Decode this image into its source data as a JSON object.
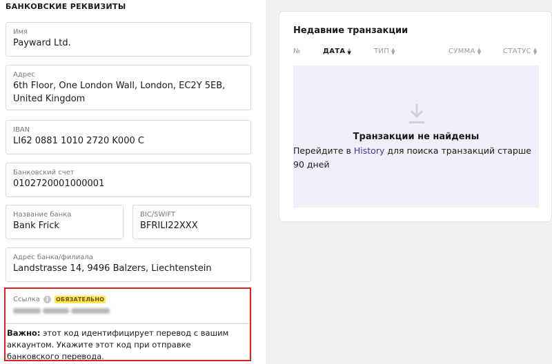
{
  "bank_details": {
    "section_title": "БАНКОВСКИЕ РЕКВИЗИТЫ",
    "name": {
      "label": "Имя",
      "value": "Payward Ltd."
    },
    "address": {
      "label": "Адрес",
      "value": "6th Floor, One London Wall, London, EC2Y 5EB, United Kingdom"
    },
    "iban": {
      "label": "IBAN",
      "value": "LI62 0881 1010 2720 K000 C"
    },
    "account": {
      "label": "Банковский счет",
      "value": "0102720001000001"
    },
    "bank_name": {
      "label": "Название банка",
      "value": "Bank Frick"
    },
    "swift": {
      "label": "BIC/SWIFT",
      "value": "BFRILI22XXX"
    },
    "bank_address": {
      "label": "Адрес банка/филиала",
      "value": "Landstrasse 14, 9496 Balzers, Liechtenstein"
    },
    "reference": {
      "label": "Ссылка",
      "badge": "ОБЯЗАТЕЛЬНО",
      "note_bold": "Важно:",
      "note_text": " этот код идентифицирует перевод с вашим аккаунтом. Укажите этот код при отправке банковского перевода."
    }
  },
  "transactions": {
    "title": "Недавние транзакции",
    "columns": {
      "num": "№",
      "date": "ДАТА",
      "type": "ТИП",
      "amount": "СУММА",
      "status": "СТАТУС"
    },
    "empty_title": "Транзакции не найдены",
    "empty_desc_before": "Перейдите в ",
    "empty_link": "History",
    "empty_desc_after": " для поиска транзакций старше 90 дней"
  },
  "colors": {
    "highlight_border": "#e01e1e",
    "badge_bg": "#ffe45c",
    "link": "#3b3aa3",
    "empty_bg": "#f1f0fa"
  }
}
